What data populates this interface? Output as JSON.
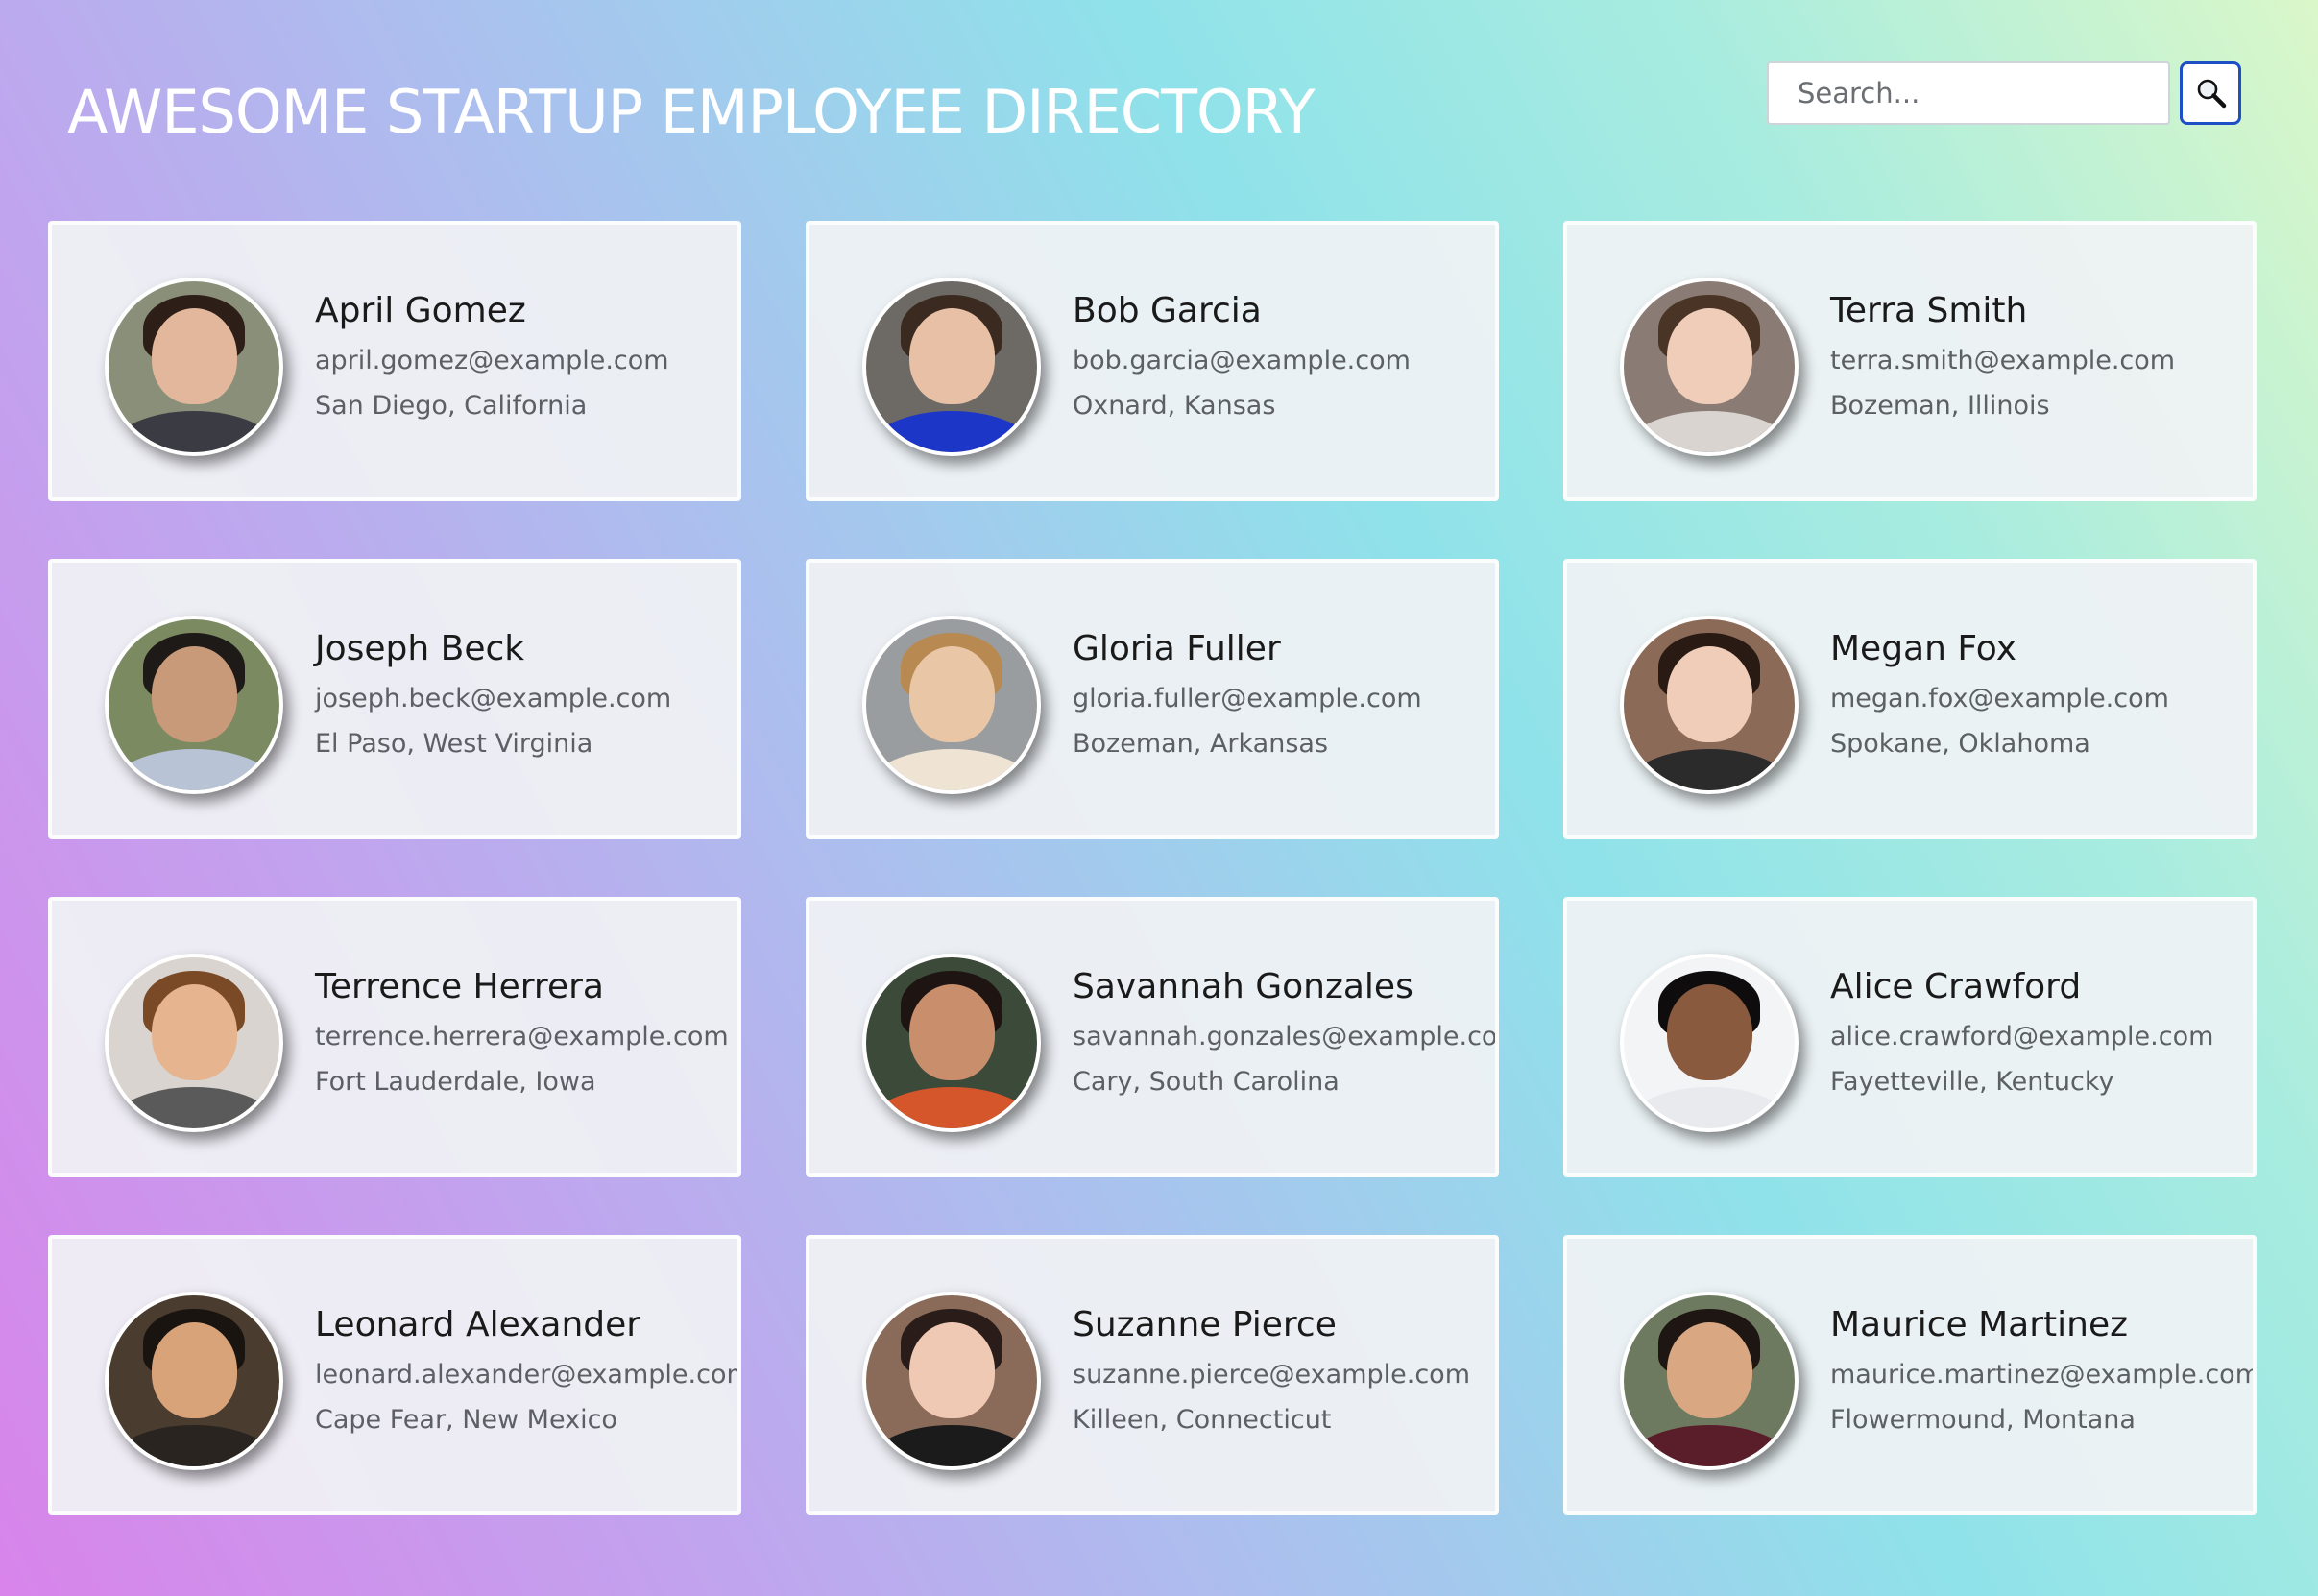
{
  "header": {
    "title": "AWESOME STARTUP EMPLOYEE DIRECTORY"
  },
  "search": {
    "placeholder": "Search...",
    "button_icon": "magnifier-icon"
  },
  "employees": [
    {
      "name": "April Gomez",
      "email": "april.gomez@example.com",
      "location": "San Diego, California",
      "avatar": {
        "bg": "#8a8f7a",
        "skin": "#e2b79b",
        "hair": "#2d1f18",
        "top": "#3b3b44"
      }
    },
    {
      "name": "Bob Garcia",
      "email": "bob.garcia@example.com",
      "location": "Oxnard, Kansas",
      "avatar": {
        "bg": "#6d6a66",
        "skin": "#e7c0a6",
        "hair": "#3a2a20",
        "top": "#1c36c8"
      }
    },
    {
      "name": "Terra Smith",
      "email": "terra.smith@example.com",
      "location": "Bozeman, Illinois",
      "avatar": {
        "bg": "#8a7c74",
        "skin": "#efcdb9",
        "hair": "#4a3426",
        "top": "#d9d4d0"
      }
    },
    {
      "name": "Joseph Beck",
      "email": "joseph.beck@example.com",
      "location": "El Paso, West Virginia",
      "avatar": {
        "bg": "#7c8a62",
        "skin": "#c99a7a",
        "hair": "#1e1a18",
        "top": "#b8c4d6"
      }
    },
    {
      "name": "Gloria Fuller",
      "email": "gloria.fuller@example.com",
      "location": "Bozeman, Arkansas",
      "avatar": {
        "bg": "#9a9da0",
        "skin": "#e9c6a6",
        "hair": "#b88a52",
        "top": "#efe4d4"
      }
    },
    {
      "name": "Megan Fox",
      "email": "megan.fox@example.com",
      "location": "Spokane, Oklahoma",
      "avatar": {
        "bg": "#8c6a58",
        "skin": "#f0cdb8",
        "hair": "#2a1a14",
        "top": "#2b2b2b"
      }
    },
    {
      "name": "Terrence Herrera",
      "email": "terrence.herrera@example.com",
      "location": "Fort Lauderdale, Iowa",
      "avatar": {
        "bg": "#d9d4cf",
        "skin": "#e6b58f",
        "hair": "#7a4a26",
        "top": "#5a5a5a"
      }
    },
    {
      "name": "Savannah Gonzales",
      "email": "savannah.gonzales@example.com",
      "location": "Cary, South Carolina",
      "avatar": {
        "bg": "#3c4a3a",
        "skin": "#c98f6c",
        "hair": "#1e1412",
        "top": "#d6562c"
      }
    },
    {
      "name": "Alice Crawford",
      "email": "alice.crawford@example.com",
      "location": "Fayetteville, Kentucky",
      "avatar": {
        "bg": "#f3f4f6",
        "skin": "#8a5a3e",
        "hair": "#0e0c0c",
        "top": "#e9eaee"
      }
    },
    {
      "name": "Leonard Alexander",
      "email": "leonard.alexander@example.com",
      "location": "Cape Fear, New Mexico",
      "avatar": {
        "bg": "#4a3c2e",
        "skin": "#d9a37a",
        "hair": "#1a1410",
        "top": "#2a2420"
      }
    },
    {
      "name": "Suzanne Pierce",
      "email": "suzanne.pierce@example.com",
      "location": "Killeen, Connecticut",
      "avatar": {
        "bg": "#8a6a58",
        "skin": "#efc9b4",
        "hair": "#2a1c18",
        "top": "#1b1b1b"
      }
    },
    {
      "name": "Maurice Martinez",
      "email": "maurice.martinez@example.com",
      "location": "Flowermound, Montana",
      "avatar": {
        "bg": "#6e7a60",
        "skin": "#d9a882",
        "hair": "#1e1612",
        "top": "#5a1e2a"
      }
    }
  ]
}
